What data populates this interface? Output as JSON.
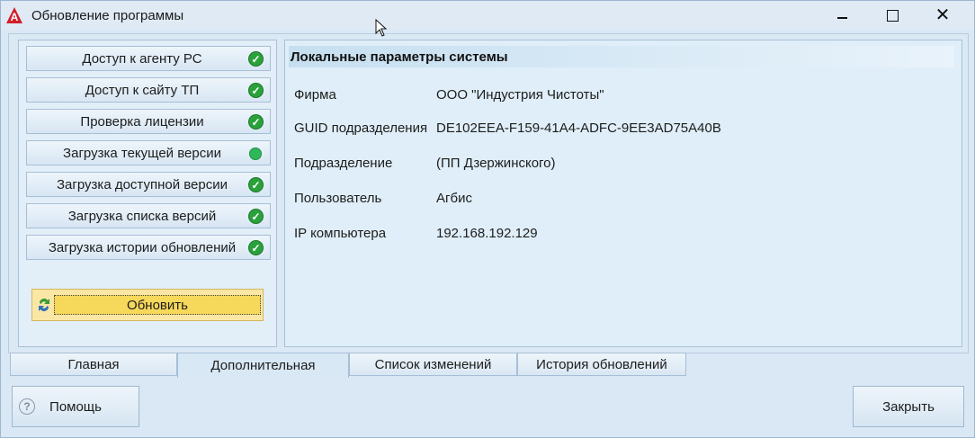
{
  "window": {
    "title": "Обновление программы",
    "icons": {
      "app": "app-logo-icon",
      "minimize": "minimize-icon",
      "maximize": "maximize-icon",
      "close": "close-icon"
    }
  },
  "status_list": {
    "items": [
      {
        "label": "Доступ к агенту РС",
        "status": "ok",
        "icon": "check-icon"
      },
      {
        "label": "Доступ к сайту ТП",
        "status": "ok",
        "icon": "check-icon"
      },
      {
        "label": "Проверка лицензии",
        "status": "ok",
        "icon": "check-icon"
      },
      {
        "label": "Загрузка текущей версии",
        "status": "in-progress",
        "icon": "green-dot-icon"
      },
      {
        "label": "Загрузка доступной версии",
        "status": "ok",
        "icon": "check-icon"
      },
      {
        "label": "Загрузка списка версий",
        "status": "ok",
        "icon": "check-icon"
      },
      {
        "label": "Загрузка истории  обновлений",
        "status": "ok",
        "icon": "check-icon"
      }
    ],
    "refresh_label": "Обновить",
    "refresh_icon": "refresh-icon"
  },
  "params": {
    "title": "Локальные параметры системы",
    "rows": [
      {
        "label": "Фирма",
        "value": "ООО \"Индустрия Чистоты\""
      },
      {
        "label": "GUID подразделения",
        "value": "DE102EEA-F159-41A4-ADFC-9EE3AD75A40B"
      },
      {
        "label": "Подразделение",
        "value": "(ПП Дзержинского)"
      },
      {
        "label": "Пользователь",
        "value": "Агбис"
      },
      {
        "label": "IP компьютера",
        "value": "192.168.192.129"
      }
    ]
  },
  "tabs": [
    {
      "label": "Главная",
      "active": false
    },
    {
      "label": "Дополнительная",
      "active": true
    },
    {
      "label": "Список изменений",
      "active": false
    },
    {
      "label": "История обновлений",
      "active": false
    }
  ],
  "footer": {
    "help_label": "Помощь",
    "help_icon": "question-icon",
    "close_label": "Закрыть"
  },
  "colors": {
    "check_green": "#2aa13b",
    "refresh_button": "#f6d85a",
    "window_bg": "#d9e8f4"
  }
}
